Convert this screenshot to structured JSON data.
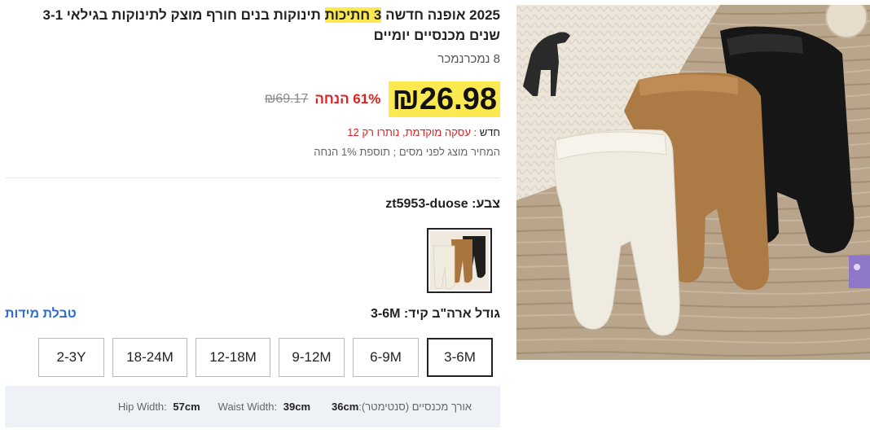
{
  "product": {
    "title_part1": "2025 אופנה חדשה ",
    "title_highlight": "3 חתיכות",
    "title_part2": " תינוקות בנים חורף מוצק לתינוקות בגילאי 3-1 שנים מכנסיים יומיים",
    "sold_text": "8 נמכרנמכר"
  },
  "price": {
    "current": "₪26.98",
    "discount": "61% הנחה",
    "original": "₪69.17",
    "promo_tag": "חדש",
    "promo_sep": " : ",
    "promo_text": "עסקה מוקדמת, נותרו רק 12",
    "tax_note": "המחיר מוצג לפני מסים ; תוספת 1% הנחה"
  },
  "color": {
    "label": "צבע: zt5953-duose"
  },
  "size": {
    "label": "גודל ארה\"ב קיד: 3-6M",
    "chart_link": "טבלת מידות",
    "options": [
      "3-6M",
      "6-9M",
      "9-12M",
      "12-18M",
      "18-24M",
      "2-3Y"
    ],
    "selected": "3-6M"
  },
  "measurements": {
    "length_label": "אורך מכנסיים (סנטימטר):",
    "length_value": "36cm",
    "waist_label": "Waist Width:",
    "waist_value": "39cm",
    "hip_label": "Hip Width:",
    "hip_value": "57cm"
  },
  "colors": {
    "highlight": "#fce94f",
    "discount_red": "#e02020",
    "link_blue": "#2d6bd6"
  }
}
